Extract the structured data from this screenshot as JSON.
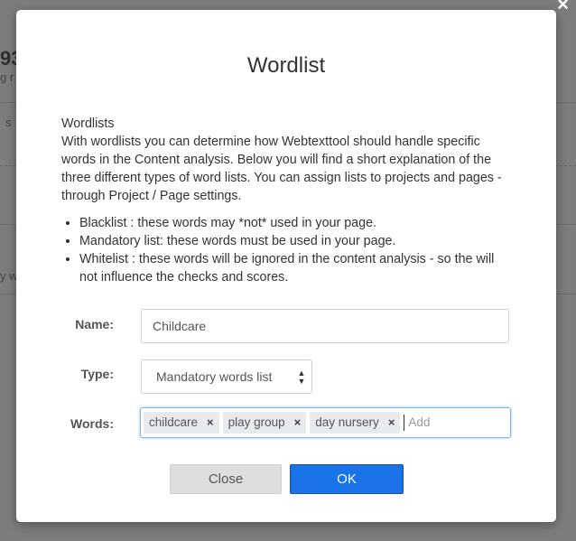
{
  "background": {
    "frag1": "93",
    "frag2": "g r",
    "frag3": "s",
    "frag4": "y w"
  },
  "modal": {
    "close_glyph": "×",
    "title": "Wordlist",
    "intro_heading": "Wordlists",
    "intro_text": "With wordlists you can determine how Webtexttool should handle specific words in the Content analysis. Below you will find a short explanation of the three different types of word lists. You can assign lists to projects and pages - through Project / Page settings.",
    "bullets": [
      "Blacklist : these words may *not* used in your page.",
      "Mandatory list: these words must be used in your page.",
      "Whitelist : these words will be ignored in the content analysis - so the will not influence the checks and scores."
    ],
    "name_label": "Name:",
    "name_value": "Childcare",
    "type_label": "Type:",
    "type_value": "Mandatory words list",
    "type_caret": "▲▼",
    "words_label": "Words:",
    "tags": [
      "childcare",
      "play group",
      "day nursery"
    ],
    "tag_remove": "×",
    "words_placeholder": "Add",
    "close_button": "Close",
    "ok_button": "OK"
  },
  "colors": {
    "ok_blue": "#1a73e8",
    "overlay": "#7d7d7d"
  }
}
